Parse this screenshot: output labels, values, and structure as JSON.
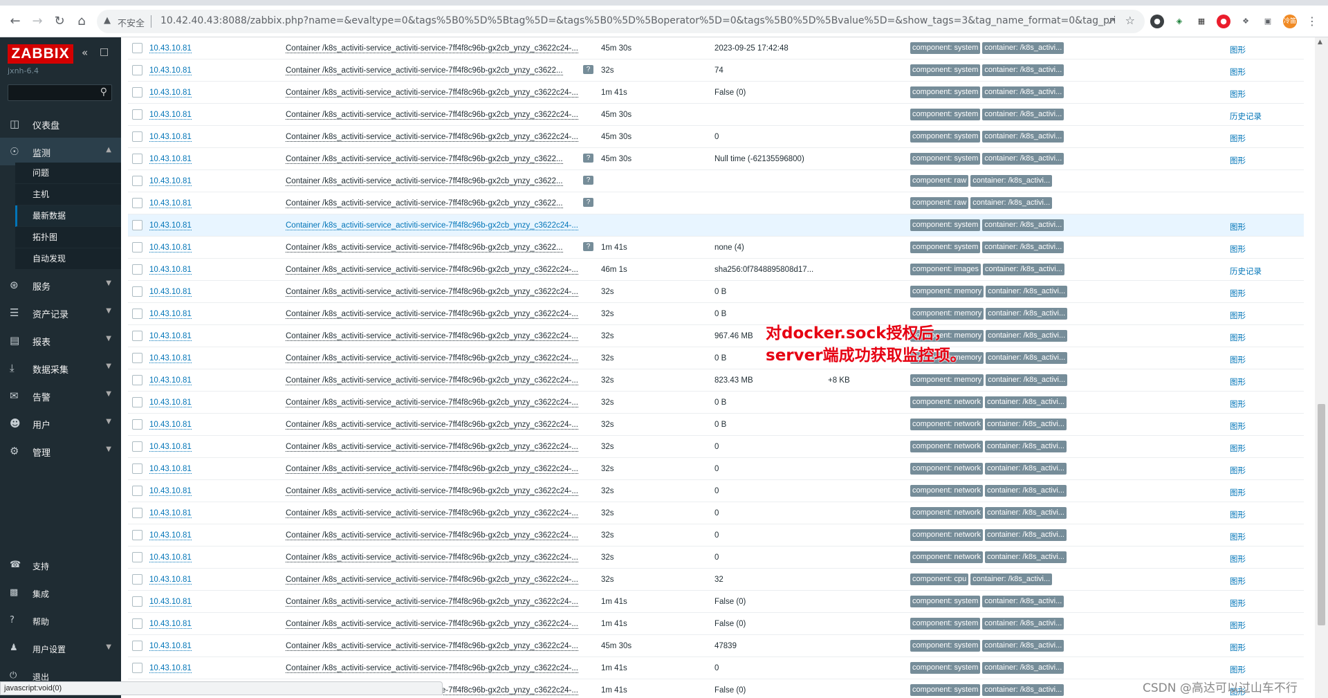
{
  "browser": {
    "insecure_label": "不安全",
    "url": "10.42.40.43:8088/zabbix.php?name=&evaltype=0&tags%5B0%5D%5Btag%5D=&tags%5B0%5D%5Boperator%5D=0&tags%5B0%5D%5Bvalue%5D=&show_tags=3&tag_name_format=0&tag_priority...",
    "profile_badge": "冷笛"
  },
  "sidebar": {
    "logo": "ZABBIX",
    "server_name": "jxnh-6.4",
    "menu": [
      {
        "label": "仪表盘",
        "icon": "dashboard-icon",
        "expandable": false
      },
      {
        "label": "监测",
        "icon": "eye-icon",
        "expandable": true,
        "expanded": true
      },
      {
        "label": "服务",
        "icon": "services-icon",
        "expandable": true
      },
      {
        "label": "资产记录",
        "icon": "list-icon",
        "expandable": true
      },
      {
        "label": "报表",
        "icon": "report-icon",
        "expandable": true
      },
      {
        "label": "数据采集",
        "icon": "download-icon",
        "expandable": true
      },
      {
        "label": "告警",
        "icon": "mail-icon",
        "expandable": true
      },
      {
        "label": "用户",
        "icon": "users-icon",
        "expandable": true
      },
      {
        "label": "管理",
        "icon": "gear-icon",
        "expandable": true
      }
    ],
    "submenu": [
      "问题",
      "主机",
      "最新数据",
      "拓扑图",
      "自动发现"
    ],
    "submenu_selected": "最新数据",
    "bottom_menu": [
      {
        "label": "支持",
        "icon": "headset-icon"
      },
      {
        "label": "集成",
        "icon": "integrations-icon"
      },
      {
        "label": "帮助",
        "icon": "help-icon"
      },
      {
        "label": "用户设置",
        "icon": "user-icon"
      },
      {
        "label": "退出",
        "icon": "power-icon"
      }
    ]
  },
  "table": {
    "rows": [
      {
        "host": "10.43.10.81",
        "name": "Container /k8s_activiti-service_activiti-service-7ff4f8c96b-gx2cb_ynzy_c3622c24-...",
        "info": false,
        "interval": "45m 30s",
        "value": "2023-09-25 17:42:48",
        "change": "",
        "tags": [
          "component: system",
          "container: /k8s_activi..."
        ],
        "action": "图形",
        "highlight": false
      },
      {
        "host": "10.43.10.81",
        "name": "Container /k8s_activiti-service_activiti-service-7ff4f8c96b-gx2cb_ynzy_c3622...",
        "info": true,
        "interval": "32s",
        "value": "74",
        "change": "",
        "tags": [
          "component: system",
          "container: /k8s_activi..."
        ],
        "action": "图形",
        "highlight": false
      },
      {
        "host": "10.43.10.81",
        "name": "Container /k8s_activiti-service_activiti-service-7ff4f8c96b-gx2cb_ynzy_c3622c24-...",
        "info": false,
        "interval": "1m 41s",
        "value": "False (0)",
        "change": "",
        "tags": [
          "component: system",
          "container: /k8s_activi..."
        ],
        "action": "图形",
        "highlight": false
      },
      {
        "host": "10.43.10.81",
        "name": "Container /k8s_activiti-service_activiti-service-7ff4f8c96b-gx2cb_ynzy_c3622c24-...",
        "info": false,
        "interval": "45m 30s",
        "value": "",
        "change": "",
        "tags": [
          "component: system",
          "container: /k8s_activi..."
        ],
        "action": "历史记录",
        "highlight": false
      },
      {
        "host": "10.43.10.81",
        "name": "Container /k8s_activiti-service_activiti-service-7ff4f8c96b-gx2cb_ynzy_c3622c24-...",
        "info": false,
        "interval": "45m 30s",
        "value": "0",
        "change": "",
        "tags": [
          "component: system",
          "container: /k8s_activi..."
        ],
        "action": "图形",
        "highlight": false
      },
      {
        "host": "10.43.10.81",
        "name": "Container /k8s_activiti-service_activiti-service-7ff4f8c96b-gx2cb_ynzy_c3622...",
        "info": true,
        "interval": "45m 30s",
        "value": "Null time (-62135596800)",
        "change": "",
        "tags": [
          "component: system",
          "container: /k8s_activi..."
        ],
        "action": "图形",
        "highlight": false
      },
      {
        "host": "10.43.10.81",
        "name": "Container /k8s_activiti-service_activiti-service-7ff4f8c96b-gx2cb_ynzy_c3622...",
        "info": true,
        "interval": "",
        "value": "",
        "change": "",
        "tags": [
          "component: raw",
          "container: /k8s_activi..."
        ],
        "action": "",
        "highlight": false
      },
      {
        "host": "10.43.10.81",
        "name": "Container /k8s_activiti-service_activiti-service-7ff4f8c96b-gx2cb_ynzy_c3622...",
        "info": true,
        "interval": "",
        "value": "",
        "change": "",
        "tags": [
          "component: raw",
          "container: /k8s_activi..."
        ],
        "action": "",
        "highlight": false
      },
      {
        "host": "10.43.10.81",
        "name": "Container /k8s_activiti-service_activiti-service-7ff4f8c96b-gx2cb_ynzy_c3622c24-...",
        "info": false,
        "interval": "",
        "value": "",
        "change": "",
        "tags": [
          "component: system",
          "container: /k8s_activi..."
        ],
        "action": "图形",
        "highlight": true
      },
      {
        "host": "10.43.10.81",
        "name": "Container /k8s_activiti-service_activiti-service-7ff4f8c96b-gx2cb_ynzy_c3622...",
        "info": true,
        "interval": "1m 41s",
        "value": "none (4)",
        "change": "",
        "tags": [
          "component: system",
          "container: /k8s_activi..."
        ],
        "action": "图形",
        "highlight": false
      },
      {
        "host": "10.43.10.81",
        "name": "Container /k8s_activiti-service_activiti-service-7ff4f8c96b-gx2cb_ynzy_c3622c24-...",
        "info": false,
        "interval": "46m 1s",
        "value": "sha256:0f7848895808d17...",
        "change": "",
        "tags": [
          "component: images",
          "container: /k8s_activi..."
        ],
        "action": "历史记录",
        "highlight": false
      },
      {
        "host": "10.43.10.81",
        "name": "Container /k8s_activiti-service_activiti-service-7ff4f8c96b-gx2cb_ynzy_c3622c24-...",
        "info": false,
        "interval": "32s",
        "value": "0 B",
        "change": "",
        "tags": [
          "component: memory",
          "container: /k8s_activi..."
        ],
        "action": "图形",
        "highlight": false
      },
      {
        "host": "10.43.10.81",
        "name": "Container /k8s_activiti-service_activiti-service-7ff4f8c96b-gx2cb_ynzy_c3622c24-...",
        "info": false,
        "interval": "32s",
        "value": "0 B",
        "change": "",
        "tags": [
          "component: memory",
          "container: /k8s_activi..."
        ],
        "action": "图形",
        "highlight": false
      },
      {
        "host": "10.43.10.81",
        "name": "Container /k8s_activiti-service_activiti-service-7ff4f8c96b-gx2cb_ynzy_c3622c24-...",
        "info": false,
        "interval": "32s",
        "value": "967.46 MB",
        "change": "",
        "tags": [
          "component: memory",
          "container: /k8s_activi..."
        ],
        "action": "图形",
        "highlight": false
      },
      {
        "host": "10.43.10.81",
        "name": "Container /k8s_activiti-service_activiti-service-7ff4f8c96b-gx2cb_ynzy_c3622c24-...",
        "info": false,
        "interval": "32s",
        "value": "0 B",
        "change": "",
        "tags": [
          "component: memory",
          "container: /k8s_activi..."
        ],
        "action": "图形",
        "highlight": false
      },
      {
        "host": "10.43.10.81",
        "name": "Container /k8s_activiti-service_activiti-service-7ff4f8c96b-gx2cb_ynzy_c3622c24-...",
        "info": false,
        "interval": "32s",
        "value": "823.43 MB",
        "change": "+8 KB",
        "tags": [
          "component: memory",
          "container: /k8s_activi..."
        ],
        "action": "图形",
        "highlight": false
      },
      {
        "host": "10.43.10.81",
        "name": "Container /k8s_activiti-service_activiti-service-7ff4f8c96b-gx2cb_ynzy_c3622c24-...",
        "info": false,
        "interval": "32s",
        "value": "0 B",
        "change": "",
        "tags": [
          "component: network",
          "container: /k8s_activi..."
        ],
        "action": "图形",
        "highlight": false
      },
      {
        "host": "10.43.10.81",
        "name": "Container /k8s_activiti-service_activiti-service-7ff4f8c96b-gx2cb_ynzy_c3622c24-...",
        "info": false,
        "interval": "32s",
        "value": "0 B",
        "change": "",
        "tags": [
          "component: network",
          "container: /k8s_activi..."
        ],
        "action": "图形",
        "highlight": false
      },
      {
        "host": "10.43.10.81",
        "name": "Container /k8s_activiti-service_activiti-service-7ff4f8c96b-gx2cb_ynzy_c3622c24-...",
        "info": false,
        "interval": "32s",
        "value": "0",
        "change": "",
        "tags": [
          "component: network",
          "container: /k8s_activi..."
        ],
        "action": "图形",
        "highlight": false
      },
      {
        "host": "10.43.10.81",
        "name": "Container /k8s_activiti-service_activiti-service-7ff4f8c96b-gx2cb_ynzy_c3622c24-...",
        "info": false,
        "interval": "32s",
        "value": "0",
        "change": "",
        "tags": [
          "component: network",
          "container: /k8s_activi..."
        ],
        "action": "图形",
        "highlight": false
      },
      {
        "host": "10.43.10.81",
        "name": "Container /k8s_activiti-service_activiti-service-7ff4f8c96b-gx2cb_ynzy_c3622c24-...",
        "info": false,
        "interval": "32s",
        "value": "0",
        "change": "",
        "tags": [
          "component: network",
          "container: /k8s_activi..."
        ],
        "action": "图形",
        "highlight": false
      },
      {
        "host": "10.43.10.81",
        "name": "Container /k8s_activiti-service_activiti-service-7ff4f8c96b-gx2cb_ynzy_c3622c24-...",
        "info": false,
        "interval": "32s",
        "value": "0",
        "change": "",
        "tags": [
          "component: network",
          "container: /k8s_activi..."
        ],
        "action": "图形",
        "highlight": false
      },
      {
        "host": "10.43.10.81",
        "name": "Container /k8s_activiti-service_activiti-service-7ff4f8c96b-gx2cb_ynzy_c3622c24-...",
        "info": false,
        "interval": "32s",
        "value": "0",
        "change": "",
        "tags": [
          "component: network",
          "container: /k8s_activi..."
        ],
        "action": "图形",
        "highlight": false
      },
      {
        "host": "10.43.10.81",
        "name": "Container /k8s_activiti-service_activiti-service-7ff4f8c96b-gx2cb_ynzy_c3622c24-...",
        "info": false,
        "interval": "32s",
        "value": "0",
        "change": "",
        "tags": [
          "component: network",
          "container: /k8s_activi..."
        ],
        "action": "图形",
        "highlight": false
      },
      {
        "host": "10.43.10.81",
        "name": "Container /k8s_activiti-service_activiti-service-7ff4f8c96b-gx2cb_ynzy_c3622c24-...",
        "info": false,
        "interval": "32s",
        "value": "32",
        "change": "",
        "tags": [
          "component: cpu",
          "container: /k8s_activi..."
        ],
        "action": "图形",
        "highlight": false
      },
      {
        "host": "10.43.10.81",
        "name": "Container /k8s_activiti-service_activiti-service-7ff4f8c96b-gx2cb_ynzy_c3622c24-...",
        "info": false,
        "interval": "1m 41s",
        "value": "False (0)",
        "change": "",
        "tags": [
          "component: system",
          "container: /k8s_activi..."
        ],
        "action": "图形",
        "highlight": false
      },
      {
        "host": "10.43.10.81",
        "name": "Container /k8s_activiti-service_activiti-service-7ff4f8c96b-gx2cb_ynzy_c3622c24-...",
        "info": false,
        "interval": "1m 41s",
        "value": "False (0)",
        "change": "",
        "tags": [
          "component: system",
          "container: /k8s_activi..."
        ],
        "action": "图形",
        "highlight": false
      },
      {
        "host": "10.43.10.81",
        "name": "Container /k8s_activiti-service_activiti-service-7ff4f8c96b-gx2cb_ynzy_c3622c24-...",
        "info": false,
        "interval": "45m 30s",
        "value": "47839",
        "change": "",
        "tags": [
          "component: system",
          "container: /k8s_activi..."
        ],
        "action": "图形",
        "highlight": false
      },
      {
        "host": "10.43.10.81",
        "name": "Container /k8s_activiti-service_activiti-service-7ff4f8c96b-gx2cb_ynzy_c3622c24-...",
        "info": false,
        "interval": "1m 41s",
        "value": "0",
        "change": "",
        "tags": [
          "component: system",
          "container: /k8s_activi..."
        ],
        "action": "图形",
        "highlight": false
      },
      {
        "host": "10.43.10.81",
        "name": "Container /k8s_activiti-service_activiti-service-7ff4f8c96b-gx2cb_ynzy_c3622c24-...",
        "info": false,
        "interval": "1m 41s",
        "value": "False (0)",
        "change": "",
        "tags": [
          "component: system",
          "container: /k8s_activi..."
        ],
        "action": "图形",
        "highlight": false
      }
    ]
  },
  "overlay_annotation": [
    "对docker.sock授权后，",
    "server端成功获取监控项。"
  ],
  "status_bar": "javascript:void(0)",
  "watermark": "CSDN @高达可以过山车不行",
  "colors": {
    "sidebar": "#1f2c33",
    "logo": "#d40000",
    "link": "#0275b8",
    "tag": "#768d99",
    "annotation": "#e60012"
  }
}
